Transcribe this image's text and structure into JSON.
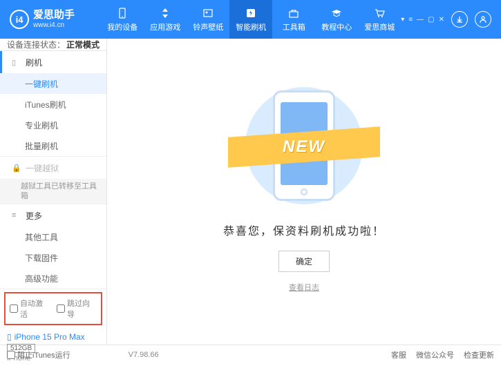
{
  "header": {
    "brand": "爱思助手",
    "url": "www.i4.cn",
    "logo_letter": "i4",
    "tabs": [
      {
        "label": "我的设备"
      },
      {
        "label": "应用游戏"
      },
      {
        "label": "铃声壁纸"
      },
      {
        "label": "智能刷机"
      },
      {
        "label": "工具箱"
      },
      {
        "label": "教程中心"
      },
      {
        "label": "爱思商城"
      }
    ]
  },
  "status": {
    "label": "设备连接状态：",
    "value": "正常模式"
  },
  "sidebar": {
    "group_flash": {
      "title": "刷机",
      "items": [
        "一键刷机",
        "iTunes刷机",
        "专业刷机",
        "批量刷机"
      ]
    },
    "group_jailbreak": {
      "title": "一键越狱",
      "note": "越狱工具已转移至工具箱"
    },
    "group_more": {
      "title": "更多",
      "items": [
        "其他工具",
        "下载固件",
        "高级功能"
      ]
    },
    "checkboxes": {
      "auto_activate": "自动激活",
      "skip_guide": "跳过向导"
    },
    "device": {
      "name": "iPhone 15 Pro Max",
      "storage": "512GB",
      "type": "iPhone"
    }
  },
  "main": {
    "ribbon": "NEW",
    "success": "恭喜您，保资料刷机成功啦！",
    "confirm": "确定",
    "log_link": "查看日志"
  },
  "footer": {
    "block_itunes": "阻止iTunes运行",
    "version": "V7.98.66",
    "links": [
      "客服",
      "微信公众号",
      "检查更新"
    ]
  }
}
